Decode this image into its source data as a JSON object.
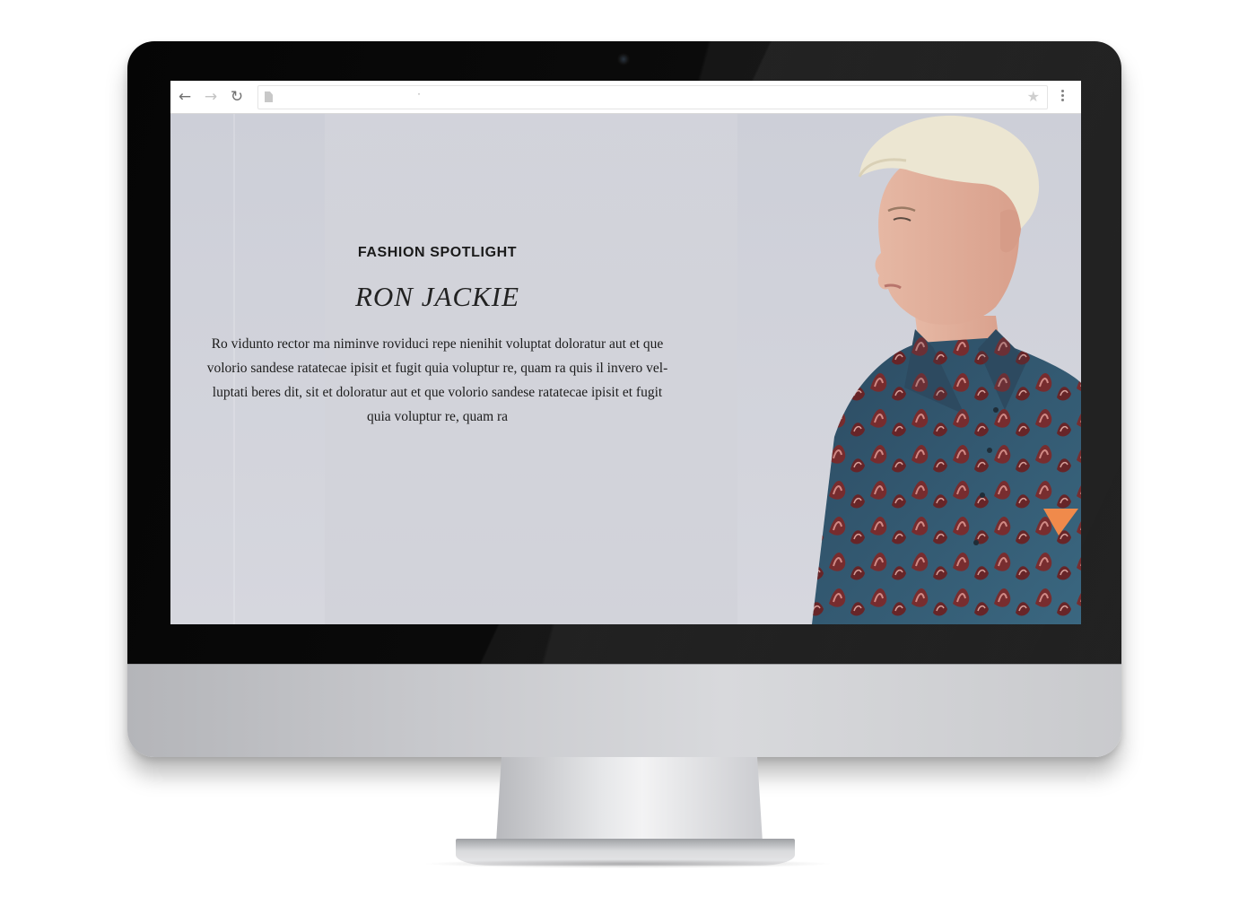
{
  "browser": {
    "back_icon": "arrow-left-icon",
    "forward_icon": "arrow-right-icon",
    "reload_icon": "reload-icon",
    "url": "·",
    "bookmark_icon": "star-icon",
    "menu_icon": "vertical-dots-icon"
  },
  "hero": {
    "eyebrow": "FASHION SPOTLIGHT",
    "name": "RON JACKIE",
    "body_lines": [
      "Ro vidunto rector ma niminve roviduci repe nienihit voluptat doloratur aut et que",
      "volorio sandese ratatecae ipisit et fugit quia voluptur re, quam ra quis il invero vel-",
      "luptati beres dit, sit et doloratur aut et que volorio sandese ratatecae ipisit et fugit",
      "quia voluptur re, quam ra"
    ],
    "image": "model-photo"
  },
  "colors": {
    "page_bg": "#cdcfd8",
    "bezel": "#0b0b0b",
    "chin": "#c7c8cc",
    "shirt_base": "#2e4f66",
    "shirt_pattern": "#7a2a2c",
    "hair": "#ece6d2",
    "badge": "#f08a4b"
  }
}
